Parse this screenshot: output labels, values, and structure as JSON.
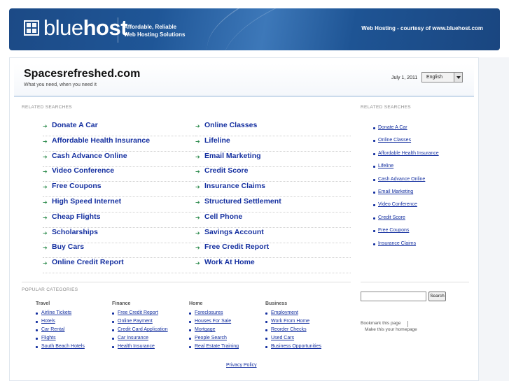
{
  "header": {
    "logo_light": "blue",
    "logo_bold": "host",
    "tagline_line1": "Affordable, Reliable",
    "tagline_line2": "Web Hosting Solutions",
    "courtesy": "Web Hosting - courtesy of www.bluehost.com"
  },
  "site": {
    "title": "Spacesrefreshed.com",
    "subtitle": "What you need, when you need it",
    "date": "July 1, 2011",
    "language": "English"
  },
  "related": {
    "label": "RELATED SEARCHES",
    "left": [
      "Donate A Car",
      "Affordable Health Insurance",
      "Cash Advance Online",
      "Video Conference",
      "Free Coupons",
      "High Speed Internet",
      "Cheap Flights",
      "Scholarships",
      "Buy Cars",
      "Online Credit Report"
    ],
    "right": [
      "Online Classes",
      "Lifeline",
      "Email Marketing",
      "Credit Score",
      "Insurance Claims",
      "Structured Settlement",
      "Cell Phone",
      "Savings Account",
      "Free Credit Report",
      "Work At Home"
    ]
  },
  "sidebar": {
    "label": "RELATED SEARCHES",
    "items": [
      "Donate A Car",
      "Online Classes",
      "Affordable Health Insurance",
      "Lifeline",
      "Cash Advance Online",
      "Email Marketing",
      "Video Conference",
      "Credit Score",
      "Free Coupons",
      "Insurance Claims"
    ],
    "search_button": "Search",
    "bookmark": "Bookmark this page",
    "homepage": "Make this your homepage"
  },
  "popular": {
    "label": "POPULAR CATEGORIES",
    "columns": [
      {
        "title": "Travel",
        "items": [
          "Airline Tickets",
          "Hotels",
          "Car Rental",
          "Flights",
          "South Beach Hotels"
        ]
      },
      {
        "title": "Finance",
        "items": [
          "Free Credit Report",
          "Online Payment",
          "Credit Card Application",
          "Car Insurance",
          "Health Insurance"
        ]
      },
      {
        "title": "Home",
        "items": [
          "Foreclosures",
          "Houses For Sale",
          "Mortgage",
          "People Search",
          "Real Estate Training"
        ]
      },
      {
        "title": "Business",
        "items": [
          "Employment",
          "Work From Home",
          "Reorder Checks",
          "Used Cars",
          "Business Opportunities"
        ]
      }
    ]
  },
  "footer": {
    "privacy": "Privacy Policy"
  },
  "colors": {
    "banner": "#1f5697",
    "link": "#1530a0",
    "arrow": "#2b8a4b"
  },
  "icons": {
    "logo": "bluehost-grid-icon",
    "bullet": "arrow-bullet-icon",
    "dropdown": "chevron-down-icon"
  }
}
